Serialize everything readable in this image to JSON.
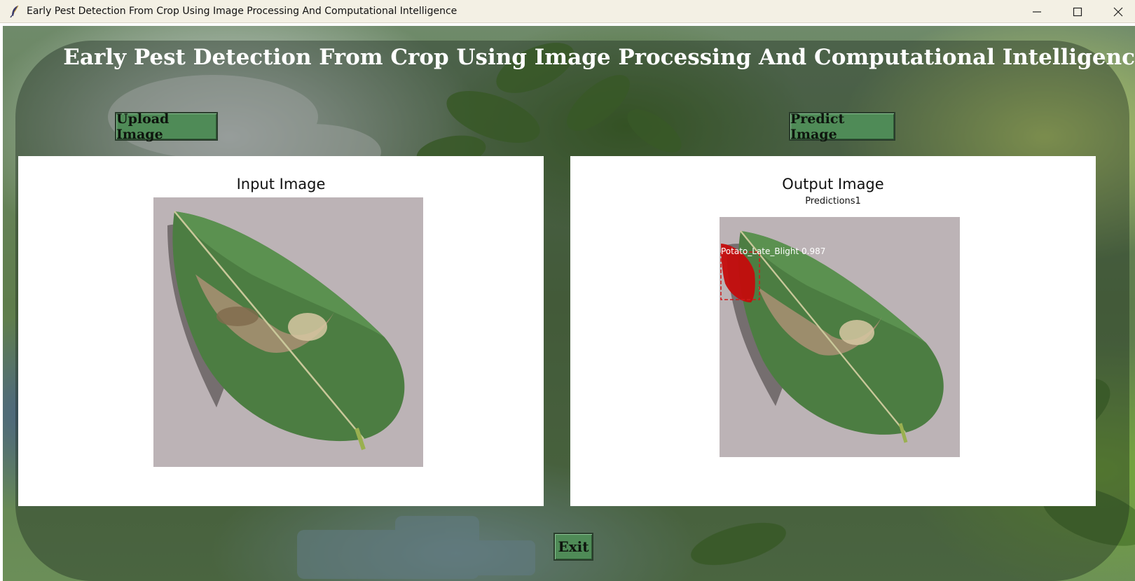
{
  "window": {
    "title": "Early Pest Detection From Crop Using Image Processing And Computational Intelligence",
    "controls": [
      "minimize-icon",
      "maximize-icon",
      "close-icon"
    ]
  },
  "app": {
    "heading": "Early Pest Detection From Crop Using Image Processing And Computational Intelligence"
  },
  "buttons": {
    "upload": "Upload Image",
    "predict": "Predict Image",
    "exit": "Exit"
  },
  "input_panel": {
    "title": "Input Image"
  },
  "output_panel": {
    "title": "Output Image",
    "subtitle": "Predictions1",
    "detection_label": "Potato_Late_Blight 0.987"
  },
  "colors": {
    "button_bg": "#4f8b57",
    "detection_box": "#d11a1a",
    "heading_text": "#ffffff"
  }
}
